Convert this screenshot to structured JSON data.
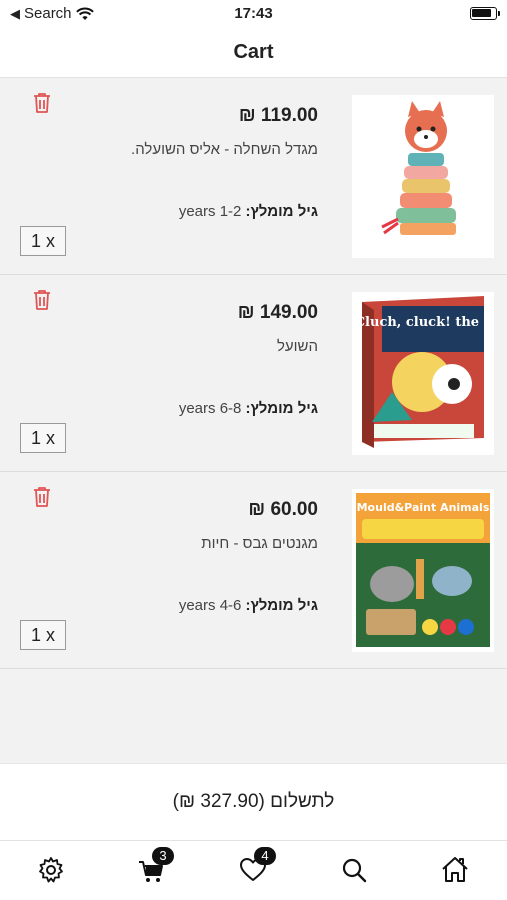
{
  "status": {
    "carrier": "Search",
    "time": "17:43"
  },
  "header": {
    "title": "Cart"
  },
  "items": [
    {
      "price": "119.00 ₪",
      "name": "מגדל השחלה - אליס השועלה.",
      "age_label": "גיל מומלץ:",
      "age_value": "1-2 years",
      "qty": "1 x"
    },
    {
      "price": "149.00 ₪",
      "name": "השועל",
      "age_label": "גיל מומלץ:",
      "age_value": "6-8 years",
      "qty": "1 x"
    },
    {
      "price": "60.00 ₪",
      "name": "מגנטים גבס - חיות",
      "age_label": "גיל מומלץ:",
      "age_value": "4-6 years",
      "qty": "1 x"
    }
  ],
  "product_images": [
    {
      "kind": "fox-stacking-toy",
      "text": ""
    },
    {
      "kind": "game-box",
      "text": "Cluch, cluck! the fox!"
    },
    {
      "kind": "kit-box",
      "text": "Mould&Paint Animals"
    }
  ],
  "checkout": {
    "label": "לתשלום (327.90 ₪)"
  },
  "tabs": [
    {
      "icon": "gear-icon"
    },
    {
      "icon": "cart-icon",
      "badge": "3"
    },
    {
      "icon": "heart-icon",
      "badge": "4"
    },
    {
      "icon": "search-icon"
    },
    {
      "icon": "home-icon"
    }
  ],
  "colors": {
    "trash": "#e05555",
    "accent": "#111111"
  }
}
